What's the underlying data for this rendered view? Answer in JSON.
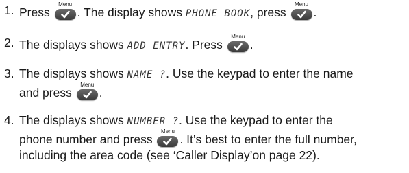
{
  "button": {
    "menu_label": "Menu"
  },
  "steps": [
    {
      "number": "1.",
      "t1": "Press ",
      "t2": ". The display shows ",
      "lcd1": "PHONE BOOK",
      "t3": ", press ",
      "t4": "."
    },
    {
      "number": "2.",
      "t1": "The displays shows ",
      "lcd1": "ADD ENTRY",
      "t2": ". Press ",
      "t3": "."
    },
    {
      "number": "3.",
      "t1": "The displays shows ",
      "lcd1": "NAME ?",
      "t2": ". Use the keypad to enter the name",
      "t3": "and press ",
      "t4": "."
    },
    {
      "number": "4.",
      "t1": "The displays shows ",
      "lcd1": "NUMBER ?",
      "t2": ". Use the keypad to enter the",
      "t3": "phone number and press ",
      "t4": ". It’s best to enter the full number,",
      "t5": "including the area code (see ‘Caller Display’on page 22)."
    }
  ]
}
